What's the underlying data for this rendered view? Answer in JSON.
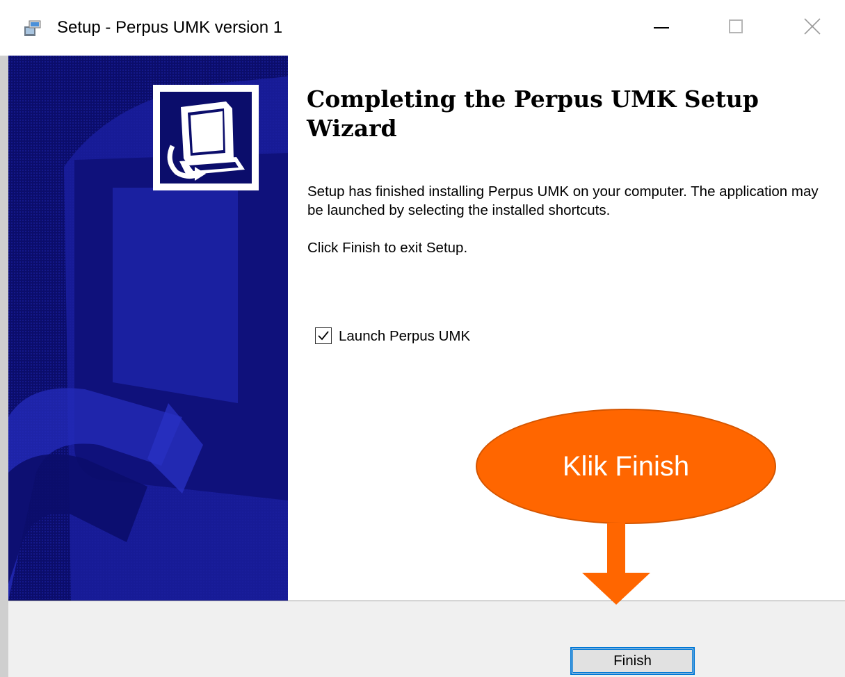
{
  "window": {
    "title": "Setup - Perpus UMK version 1",
    "icon": "setup-installer-icon",
    "controls": [
      "minimize-icon",
      "maximize-icon",
      "close-icon"
    ]
  },
  "banner": {
    "background_color": "#0b0d6b",
    "icon": "computer-install-icon"
  },
  "content": {
    "heading": "Completing the Perpus UMK Setup Wizard",
    "paragraph1": "Setup has finished installing Perpus UMK on your computer. The application may be launched by selecting the installed shortcuts.",
    "paragraph2": "Click Finish to exit Setup.",
    "launch_checkbox": {
      "label": "Launch Perpus UMK",
      "checked": true
    }
  },
  "footer": {
    "finish_label": "Finish",
    "accent_color": "#0078d7"
  },
  "annotation": {
    "text": "Klik Finish",
    "color": "#ff6600"
  }
}
